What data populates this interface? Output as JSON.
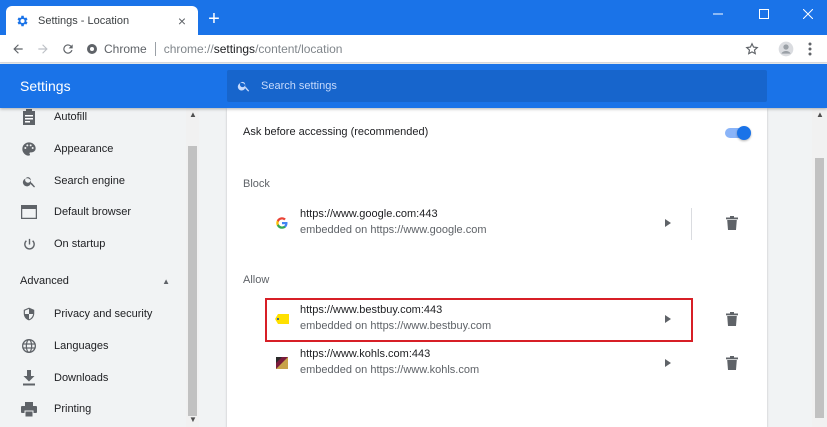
{
  "browser": {
    "tab_title": "Settings - Location",
    "omnibox_chip": "Chrome",
    "url_scheme": "chrome://",
    "url_host": "settings",
    "url_path": "/content/location"
  },
  "settings": {
    "title": "Settings",
    "search_placeholder": "Search settings"
  },
  "nav": {
    "items": [
      {
        "label": "Autofill",
        "icon": "clipboard-icon"
      },
      {
        "label": "Appearance",
        "icon": "palette-icon"
      },
      {
        "label": "Search engine",
        "icon": "search-icon"
      },
      {
        "label": "Default browser",
        "icon": "browser-icon"
      },
      {
        "label": "On startup",
        "icon": "power-icon"
      }
    ],
    "advanced_label": "Advanced",
    "advanced_items": [
      {
        "label": "Privacy and security",
        "icon": "shield-icon"
      },
      {
        "label": "Languages",
        "icon": "globe-icon"
      },
      {
        "label": "Downloads",
        "icon": "download-icon"
      },
      {
        "label": "Printing",
        "icon": "printer-icon"
      }
    ]
  },
  "location": {
    "ask_label": "Ask before accessing (recommended)",
    "ask_enabled": true,
    "block_label": "Block",
    "allow_label": "Allow",
    "blocked": [
      {
        "url": "https://www.google.com:443",
        "embedded": "embedded on https://www.google.com"
      }
    ],
    "allowed": [
      {
        "url": "https://www.bestbuy.com:443",
        "embedded": "embedded on https://www.bestbuy.com",
        "highlighted": true
      },
      {
        "url": "https://www.kohls.com:443",
        "embedded": "embedded on https://www.kohls.com"
      }
    ]
  },
  "colors": {
    "accent": "#1a73e8",
    "highlight_border": "#d71f26"
  }
}
